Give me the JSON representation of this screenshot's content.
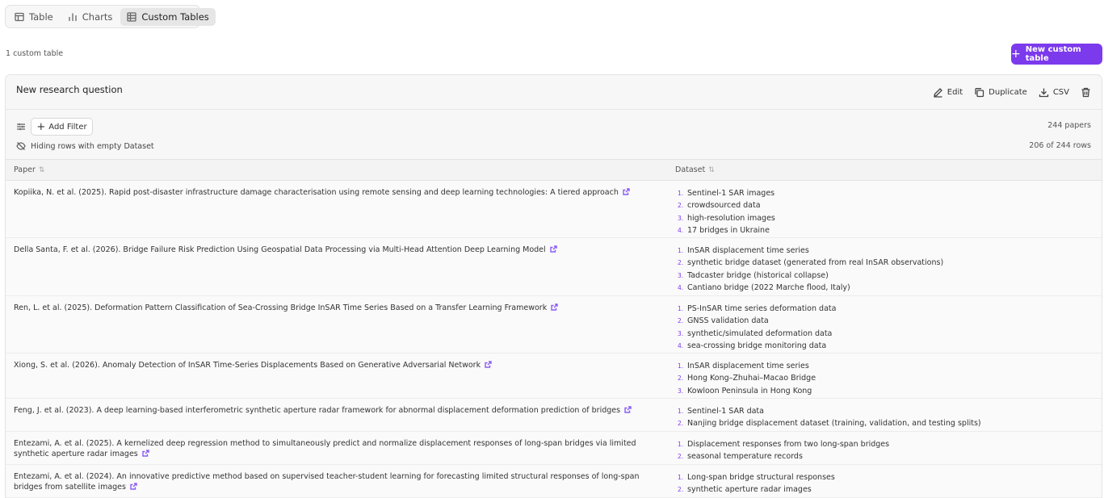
{
  "tabs": [
    {
      "label": "Table",
      "icon": "table-icon"
    },
    {
      "label": "Charts",
      "icon": "bar-chart-icon"
    },
    {
      "label": "Custom Tables",
      "icon": "grid-icon",
      "active": true
    }
  ],
  "summary": {
    "count_label": "1 custom table",
    "new_button": "New custom table"
  },
  "card": {
    "title": "New research question",
    "actions": {
      "edit": "Edit",
      "duplicate": "Duplicate",
      "csv": "CSV"
    }
  },
  "filters": {
    "add_filter": "Add Filter",
    "papers_count": "244 papers",
    "hiding_text": "Hiding rows with empty Dataset",
    "rows_count": "206 of 244 rows"
  },
  "table": {
    "columns": [
      "Paper",
      "Dataset"
    ],
    "rows": [
      {
        "paper": "Kopiika, N. et al. (2025). Rapid post-disaster infrastructure damage characterisation using remote sensing and deep learning technologies: A tiered approach",
        "datasets": [
          "Sentinel-1 SAR images",
          "crowdsourced data",
          "high-resolution images",
          "17 bridges in Ukraine"
        ]
      },
      {
        "paper": "Della Santa, F. et al. (2026). Bridge Failure Risk Prediction Using Geospatial Data Processing via Multi-Head Attention Deep Learning Model",
        "datasets": [
          "InSAR displacement time series",
          "synthetic bridge dataset (generated from real InSAR observations)",
          "Tadcaster bridge (historical collapse)",
          "Cantiano bridge (2022 Marche flood, Italy)"
        ]
      },
      {
        "paper": "Ren, L. et al. (2025). Deformation Pattern Classification of Sea-Crossing Bridge InSAR Time Series Based on a Transfer Learning Framework",
        "datasets": [
          "PS-InSAR time series deformation data",
          "GNSS validation data",
          "synthetic/simulated deformation data",
          "sea-crossing bridge monitoring data"
        ]
      },
      {
        "paper": "Xiong, S. et al. (2026). Anomaly Detection of InSAR Time-Series Displacements Based on Generative Adversarial Network",
        "datasets": [
          "InSAR displacement time series",
          "Hong Kong–Zhuhai–Macao Bridge",
          "Kowloon Peninsula in Hong Kong"
        ]
      },
      {
        "paper": "Feng, J. et al. (2023). A deep learning-based interferometric synthetic aperture radar framework for abnormal displacement deformation prediction of bridges",
        "datasets": [
          "Sentinel-1 SAR data",
          "Nanjing bridge displacement dataset (training, validation, and testing splits)"
        ]
      },
      {
        "paper": "Entezami, A. et al. (2025). A kernelized deep regression method to simultaneously predict and normalize displacement responses of long-span bridges via limited synthetic aperture radar images",
        "datasets": [
          "Displacement responses from two long-span bridges",
          "seasonal temperature records"
        ]
      },
      {
        "paper": "Entezami, A. et al. (2024). An innovative predictive method based on supervised teacher-student learning for forecasting limited structural responses of long-span bridges from satellite images",
        "datasets": [
          "Long-span bridge structural responses",
          "synthetic aperture radar images"
        ]
      }
    ]
  }
}
